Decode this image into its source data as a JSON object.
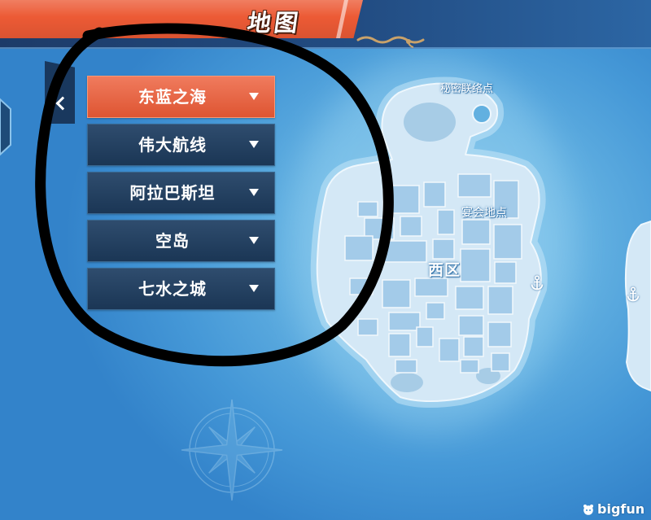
{
  "header": {
    "title": "地图"
  },
  "menu": {
    "items": [
      {
        "label": "东蓝之海",
        "selected": true
      },
      {
        "label": "伟大航线",
        "selected": false
      },
      {
        "label": "阿拉巴斯坦",
        "selected": false
      },
      {
        "label": "空岛",
        "selected": false
      },
      {
        "label": "七水之城",
        "selected": false
      }
    ],
    "item_icon": "triangle-down-icon",
    "collapse_icon": "chevron-left-icon"
  },
  "map": {
    "labels": {
      "secret_contact": "秘密联络点",
      "banquet": "宴会地点",
      "district": "西区"
    },
    "marker_icon": "anchor-icon",
    "decoration_icon": "compass-rose-icon"
  },
  "watermark": {
    "text": "bigfun",
    "icon": "bigfun-logo-icon"
  },
  "colors": {
    "accent": "#ec5a35",
    "menu_item": "#1f3f63",
    "ocean": "#3f93d4",
    "header": "#1d3b68",
    "island": "#d4e8f6",
    "annotation": "#000000"
  }
}
